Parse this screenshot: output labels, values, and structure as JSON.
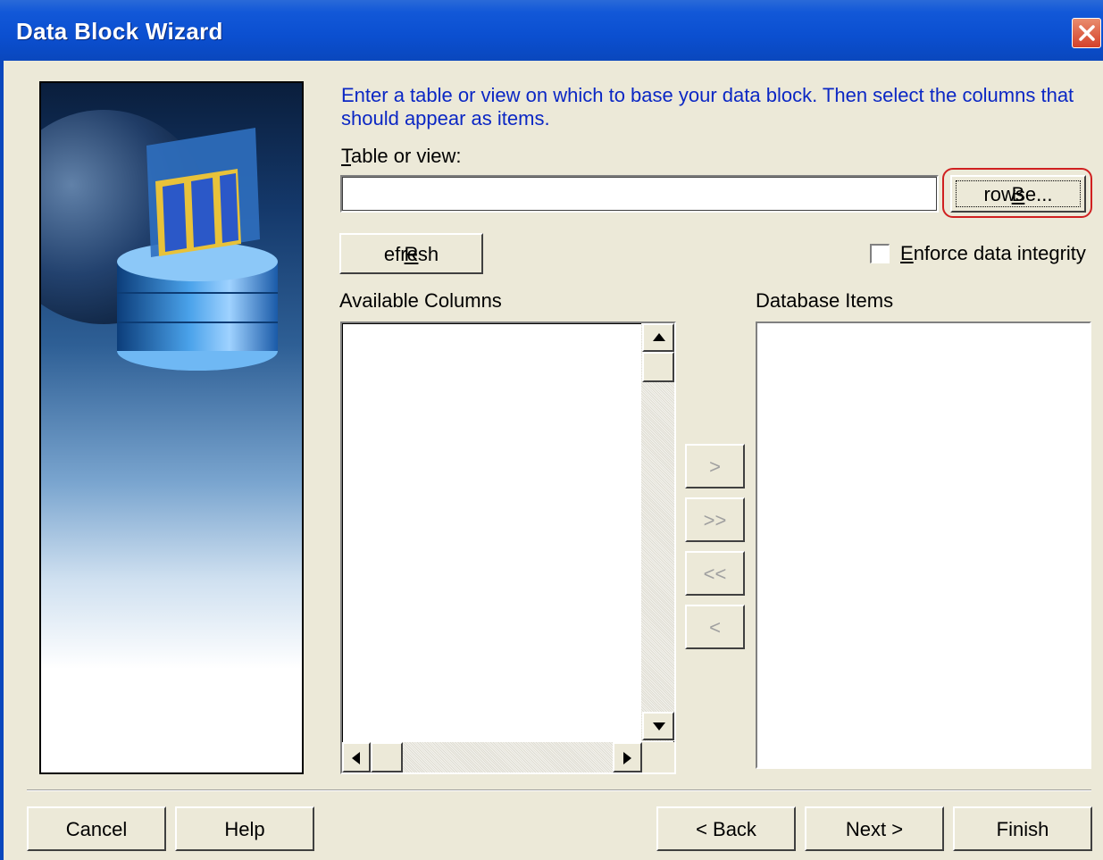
{
  "window": {
    "title": "Data Block Wizard"
  },
  "instructions": "Enter a table or view on which to base your data block. Then select the columns that should appear as items.",
  "table_or_view": {
    "label_accel": "T",
    "label_rest": "able or view:",
    "value": ""
  },
  "browse_button": {
    "accel": "B",
    "rest": "rowse..."
  },
  "refresh_button": {
    "accel": "R",
    "rest": "efresh"
  },
  "enforce_checkbox": {
    "accel": "E",
    "rest": "nforce data integrity",
    "checked": false
  },
  "available_columns": {
    "label": "Available Columns",
    "items": []
  },
  "database_items": {
    "label": "Database Items",
    "items": []
  },
  "move_buttons": {
    "move_one_right": ">",
    "move_all_right": ">>",
    "move_all_left": "<<",
    "move_one_left": "<"
  },
  "footer": {
    "cancel": "Cancel",
    "help": "Help",
    "back": "< Back",
    "next": "Next >",
    "finish": "Finish"
  }
}
